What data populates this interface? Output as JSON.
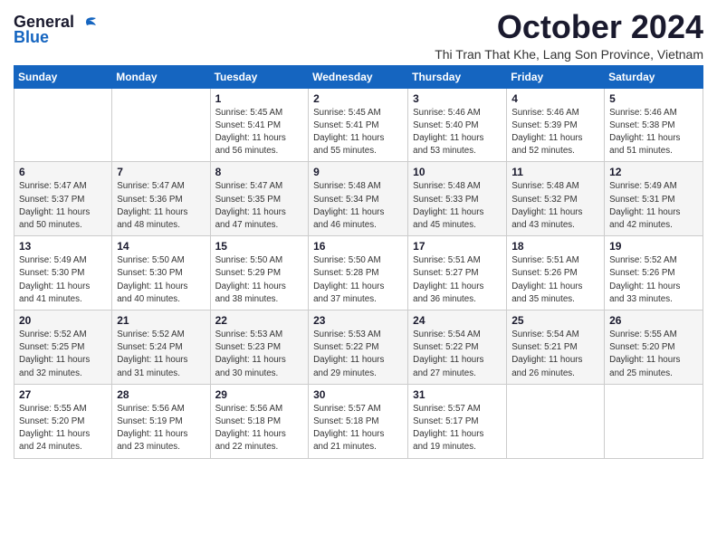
{
  "header": {
    "logo_line1": "General",
    "logo_line2": "Blue",
    "month": "October 2024",
    "location": "Thi Tran That Khe, Lang Son Province, Vietnam"
  },
  "weekdays": [
    "Sunday",
    "Monday",
    "Tuesday",
    "Wednesday",
    "Thursday",
    "Friday",
    "Saturday"
  ],
  "weeks": [
    [
      {
        "day": "",
        "info": ""
      },
      {
        "day": "",
        "info": ""
      },
      {
        "day": "1",
        "info": "Sunrise: 5:45 AM\nSunset: 5:41 PM\nDaylight: 11 hours\nand 56 minutes."
      },
      {
        "day": "2",
        "info": "Sunrise: 5:45 AM\nSunset: 5:41 PM\nDaylight: 11 hours\nand 55 minutes."
      },
      {
        "day": "3",
        "info": "Sunrise: 5:46 AM\nSunset: 5:40 PM\nDaylight: 11 hours\nand 53 minutes."
      },
      {
        "day": "4",
        "info": "Sunrise: 5:46 AM\nSunset: 5:39 PM\nDaylight: 11 hours\nand 52 minutes."
      },
      {
        "day": "5",
        "info": "Sunrise: 5:46 AM\nSunset: 5:38 PM\nDaylight: 11 hours\nand 51 minutes."
      }
    ],
    [
      {
        "day": "6",
        "info": "Sunrise: 5:47 AM\nSunset: 5:37 PM\nDaylight: 11 hours\nand 50 minutes."
      },
      {
        "day": "7",
        "info": "Sunrise: 5:47 AM\nSunset: 5:36 PM\nDaylight: 11 hours\nand 48 minutes."
      },
      {
        "day": "8",
        "info": "Sunrise: 5:47 AM\nSunset: 5:35 PM\nDaylight: 11 hours\nand 47 minutes."
      },
      {
        "day": "9",
        "info": "Sunrise: 5:48 AM\nSunset: 5:34 PM\nDaylight: 11 hours\nand 46 minutes."
      },
      {
        "day": "10",
        "info": "Sunrise: 5:48 AM\nSunset: 5:33 PM\nDaylight: 11 hours\nand 45 minutes."
      },
      {
        "day": "11",
        "info": "Sunrise: 5:48 AM\nSunset: 5:32 PM\nDaylight: 11 hours\nand 43 minutes."
      },
      {
        "day": "12",
        "info": "Sunrise: 5:49 AM\nSunset: 5:31 PM\nDaylight: 11 hours\nand 42 minutes."
      }
    ],
    [
      {
        "day": "13",
        "info": "Sunrise: 5:49 AM\nSunset: 5:30 PM\nDaylight: 11 hours\nand 41 minutes."
      },
      {
        "day": "14",
        "info": "Sunrise: 5:50 AM\nSunset: 5:30 PM\nDaylight: 11 hours\nand 40 minutes."
      },
      {
        "day": "15",
        "info": "Sunrise: 5:50 AM\nSunset: 5:29 PM\nDaylight: 11 hours\nand 38 minutes."
      },
      {
        "day": "16",
        "info": "Sunrise: 5:50 AM\nSunset: 5:28 PM\nDaylight: 11 hours\nand 37 minutes."
      },
      {
        "day": "17",
        "info": "Sunrise: 5:51 AM\nSunset: 5:27 PM\nDaylight: 11 hours\nand 36 minutes."
      },
      {
        "day": "18",
        "info": "Sunrise: 5:51 AM\nSunset: 5:26 PM\nDaylight: 11 hours\nand 35 minutes."
      },
      {
        "day": "19",
        "info": "Sunrise: 5:52 AM\nSunset: 5:26 PM\nDaylight: 11 hours\nand 33 minutes."
      }
    ],
    [
      {
        "day": "20",
        "info": "Sunrise: 5:52 AM\nSunset: 5:25 PM\nDaylight: 11 hours\nand 32 minutes."
      },
      {
        "day": "21",
        "info": "Sunrise: 5:52 AM\nSunset: 5:24 PM\nDaylight: 11 hours\nand 31 minutes."
      },
      {
        "day": "22",
        "info": "Sunrise: 5:53 AM\nSunset: 5:23 PM\nDaylight: 11 hours\nand 30 minutes."
      },
      {
        "day": "23",
        "info": "Sunrise: 5:53 AM\nSunset: 5:22 PM\nDaylight: 11 hours\nand 29 minutes."
      },
      {
        "day": "24",
        "info": "Sunrise: 5:54 AM\nSunset: 5:22 PM\nDaylight: 11 hours\nand 27 minutes."
      },
      {
        "day": "25",
        "info": "Sunrise: 5:54 AM\nSunset: 5:21 PM\nDaylight: 11 hours\nand 26 minutes."
      },
      {
        "day": "26",
        "info": "Sunrise: 5:55 AM\nSunset: 5:20 PM\nDaylight: 11 hours\nand 25 minutes."
      }
    ],
    [
      {
        "day": "27",
        "info": "Sunrise: 5:55 AM\nSunset: 5:20 PM\nDaylight: 11 hours\nand 24 minutes."
      },
      {
        "day": "28",
        "info": "Sunrise: 5:56 AM\nSunset: 5:19 PM\nDaylight: 11 hours\nand 23 minutes."
      },
      {
        "day": "29",
        "info": "Sunrise: 5:56 AM\nSunset: 5:18 PM\nDaylight: 11 hours\nand 22 minutes."
      },
      {
        "day": "30",
        "info": "Sunrise: 5:57 AM\nSunset: 5:18 PM\nDaylight: 11 hours\nand 21 minutes."
      },
      {
        "day": "31",
        "info": "Sunrise: 5:57 AM\nSunset: 5:17 PM\nDaylight: 11 hours\nand 19 minutes."
      },
      {
        "day": "",
        "info": ""
      },
      {
        "day": "",
        "info": ""
      }
    ]
  ]
}
